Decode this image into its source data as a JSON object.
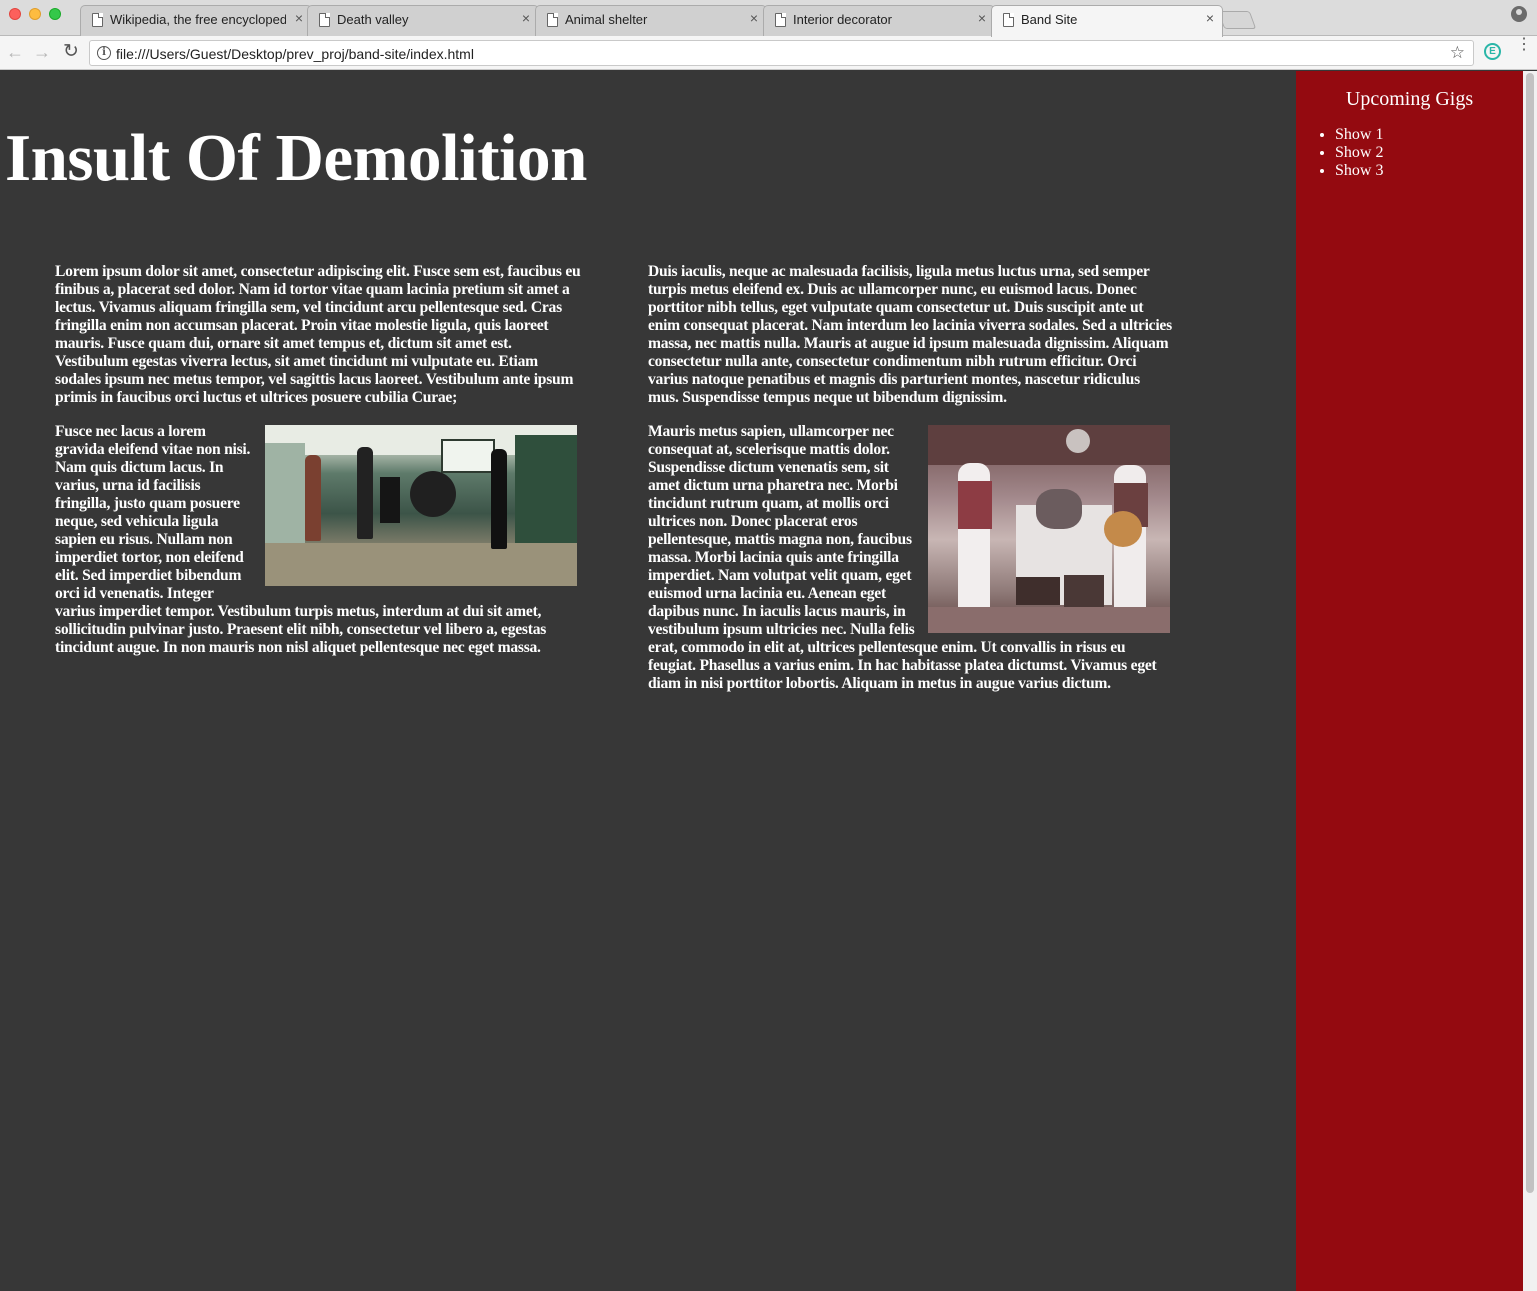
{
  "browser": {
    "tabs": [
      {
        "title": "Wikipedia, the free encycloped",
        "active": false
      },
      {
        "title": "Death valley",
        "active": false
      },
      {
        "title": "Animal shelter",
        "active": false
      },
      {
        "title": "Interior decorator",
        "active": false
      },
      {
        "title": "Band Site",
        "active": true
      }
    ],
    "close_glyph": "×",
    "url": "file:///Users/Guest/Desktop/prev_proj/band-site/index.html",
    "icons": {
      "back": "arrow-left-icon",
      "forward": "arrow-right-icon",
      "reload": "reload-icon",
      "info": "info-icon",
      "bookmark": "star-icon",
      "extension": "extension-e-icon",
      "menu": "kebab-menu-icon",
      "profile": "profile-icon"
    },
    "icon_glyphs": {
      "back": "←",
      "forward": "→",
      "reload": "↻",
      "info": "i",
      "star": "☆",
      "extension": "E",
      "menu": "⋮"
    }
  },
  "page": {
    "title": "Insult Of Demolition",
    "colors": {
      "background": "#373737",
      "sidebar": "#940a10",
      "text": "#ffffff"
    },
    "sidebar": {
      "heading": "Upcoming Gigs",
      "shows": [
        "Show 1",
        "Show 2",
        "Show 3"
      ]
    },
    "columns": {
      "left": {
        "p1": "Lorem ipsum dolor sit amet, consectetur adipiscing elit. Fusce sem est, faucibus eu finibus a, placerat sed dolor. Nam id tortor vitae quam lacinia pretium sit amet a lectus. Vivamus aliquam fringilla sem, vel tincidunt arcu pellentesque sed. Cras fringilla enim non accumsan placerat. Proin vitae molestie ligula, quis laoreet mauris. Fusce quam dui, ornare sit amet tempus et, dictum sit amet est. Vestibulum egestas viverra lectus, sit amet tincidunt mi vulputate eu. Etiam sodales ipsum nec metus tempor, vel sagittis lacus laoreet. Vestibulum ante ipsum primis in faucibus orci luctus et ultrices posuere cubilia Curae;",
        "p2": "Fusce nec lacus a lorem gravida eleifend vitae non nisi. Nam quis dictum lacus. In varius, urna id facilisis fringilla, justo quam posuere neque, sed vehicula ligula sapien eu risus. Nullam non imperdiet tortor, non eleifend elit. Sed imperdiet bibendum orci id venenatis. Integer varius imperdiet tempor. Vestibulum turpis metus, interdum at dui sit amet, sollicitudin pulvinar justo. Praesent elit nibh, consectetur vel libero a, egestas tincidunt augue. In non mauris non nisl aliquet pellentesque nec eget massa."
      },
      "right": {
        "p1": "Duis iaculis, neque ac malesuada facilisis, ligula metus luctus urna, sed semper turpis metus eleifend ex. Duis ac ullamcorper nunc, eu euismod lacus. Donec porttitor nibh tellus, eget vulputate quam consectetur ut. Duis suscipit ante ut enim consequat placerat. Nam interdum leo lacinia viverra sodales. Sed a ultricies massa, nec mattis nulla. Mauris at augue id ipsum malesuada dignissim. Aliquam consectetur nulla ante, consectetur condimentum nibh rutrum efficitur. Orci varius natoque penatibus et magnis dis parturient montes, nascetur ridiculus mus. Suspendisse tempus neque ut bibendum dignissim.",
        "p2": "Mauris metus sapien, ullamcorper nec consequat at, scelerisque mattis dolor. Suspendisse dictum venenatis sem, sit amet dictum urna pharetra nec. Morbi tincidunt rutrum quam, at mollis orci ultrices non. Donec placerat eros pellentesque, mattis magna non, faucibus massa. Morbi lacinia quis ante fringilla imperdiet. Nam volutpat velit quam, eget euismod urna lacinia eu. Aenean eget dapibus nunc. In iaculis lacus mauris, in vestibulum ipsum ultricies nec. Nulla felis erat, commodo in elit at, ultrices pellentesque enim. Ut convallis in risus eu feugiat. Phasellus a varius enim. In hac habitasse platea dictumst. Vivamus eget diam in nisi porttitor lobortis. Aliquam in metus in augue varius dictum."
      }
    }
  }
}
